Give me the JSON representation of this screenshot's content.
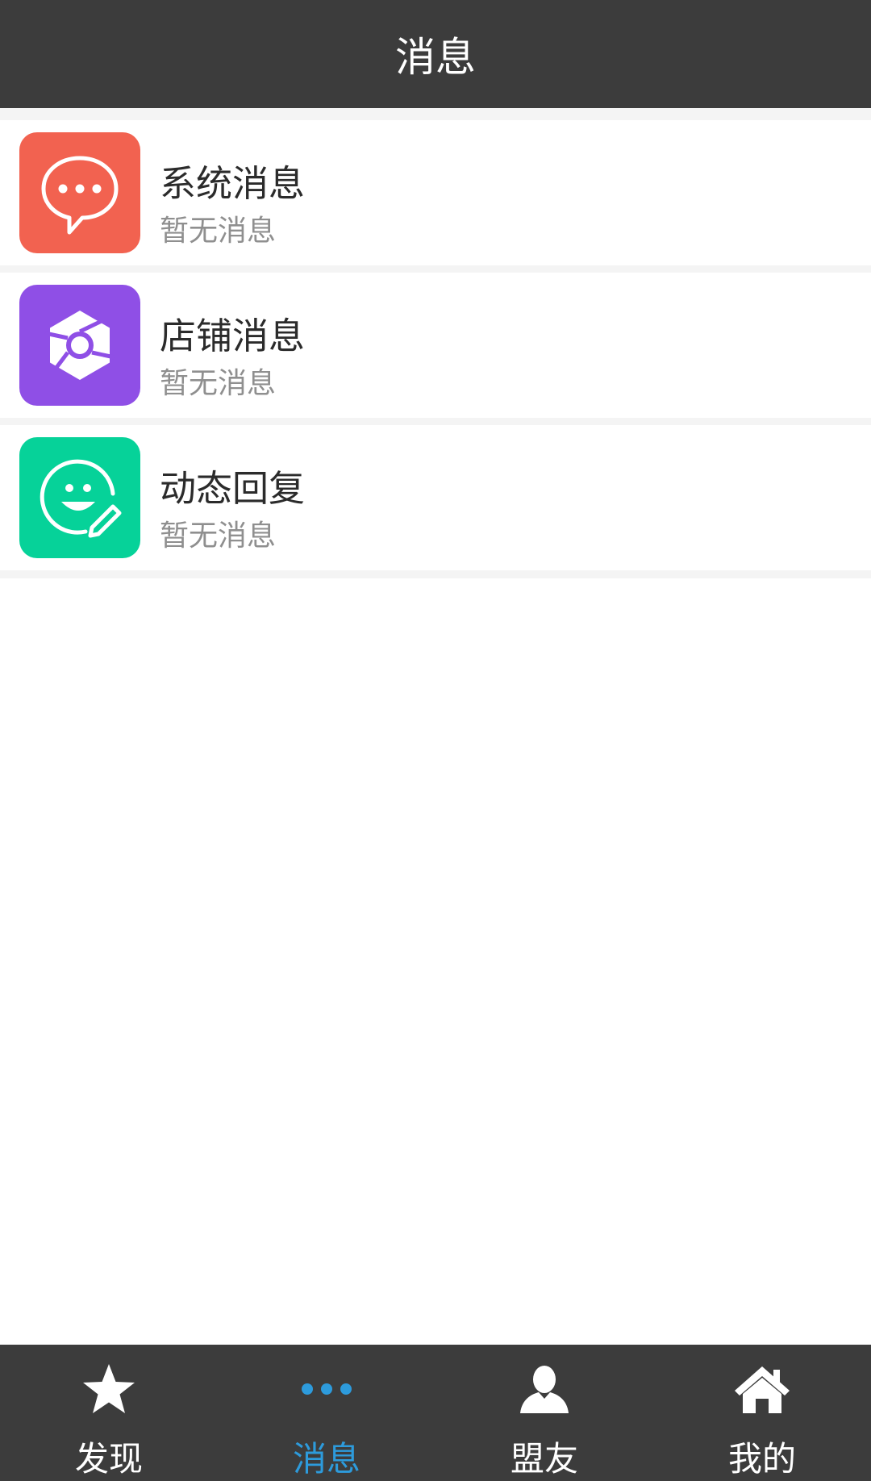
{
  "header": {
    "title": "消息"
  },
  "messages": [
    {
      "title": "系统消息",
      "subtitle": "暂无消息",
      "icon": "chat-bubble-icon",
      "color": "#f26250"
    },
    {
      "title": "店铺消息",
      "subtitle": "暂无消息",
      "icon": "shop-aperture-icon",
      "color": "#8f4fe6"
    },
    {
      "title": "动态回复",
      "subtitle": "暂无消息",
      "icon": "smile-edit-icon",
      "color": "#06d299"
    }
  ],
  "tabbar": {
    "items": [
      {
        "label": "发现",
        "icon": "star-icon"
      },
      {
        "label": "消息",
        "icon": "more-dots-icon",
        "active": true
      },
      {
        "label": "盟友",
        "icon": "person-icon"
      },
      {
        "label": "我的",
        "icon": "home-icon"
      }
    ],
    "active_color": "#2d9bdc"
  },
  "colors": {
    "bar_background": "#3c3c3c",
    "divider": "#f4f4f4"
  }
}
